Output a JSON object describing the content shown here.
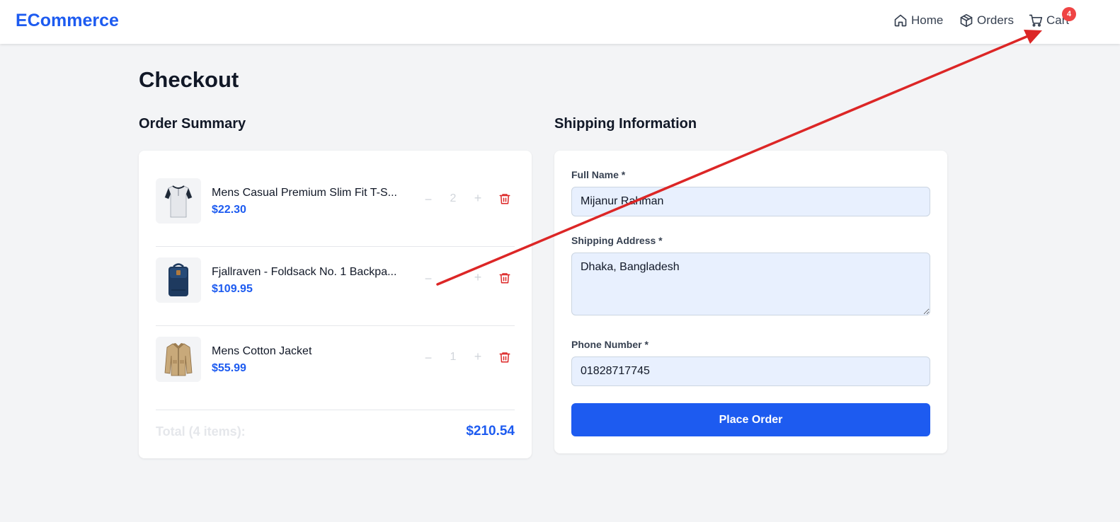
{
  "header": {
    "brand": "ECommerce",
    "nav": {
      "home": "Home",
      "orders": "Orders",
      "cart": "Cart",
      "cart_count": "4"
    }
  },
  "page": {
    "title": "Checkout"
  },
  "order_summary": {
    "title": "Order Summary",
    "items": [
      {
        "name": "Mens Casual Premium Slim Fit T-S...",
        "price": "$22.30",
        "quantity": "2",
        "image": "t-shirt"
      },
      {
        "name": "Fjallraven - Foldsack No. 1 Backpa...",
        "price": "$109.95",
        "quantity": "",
        "image": "backpack"
      },
      {
        "name": "Mens Cotton Jacket",
        "price": "$55.99",
        "quantity": "1",
        "image": "jacket"
      }
    ],
    "total_label": "Total (4 items):",
    "total_value": "$210.54"
  },
  "shipping": {
    "title": "Shipping Information",
    "full_name_label": "Full Name *",
    "full_name_value": "Mijanur Rahman",
    "address_label": "Shipping Address *",
    "address_value": "Dhaka, Bangladesh",
    "phone_label": "Phone Number *",
    "phone_value": "01828717745",
    "submit_label": "Place Order"
  },
  "colors": {
    "accent": "#1d5bf0",
    "danger": "#ef4444",
    "annotation_arrow": "#dc2626"
  }
}
